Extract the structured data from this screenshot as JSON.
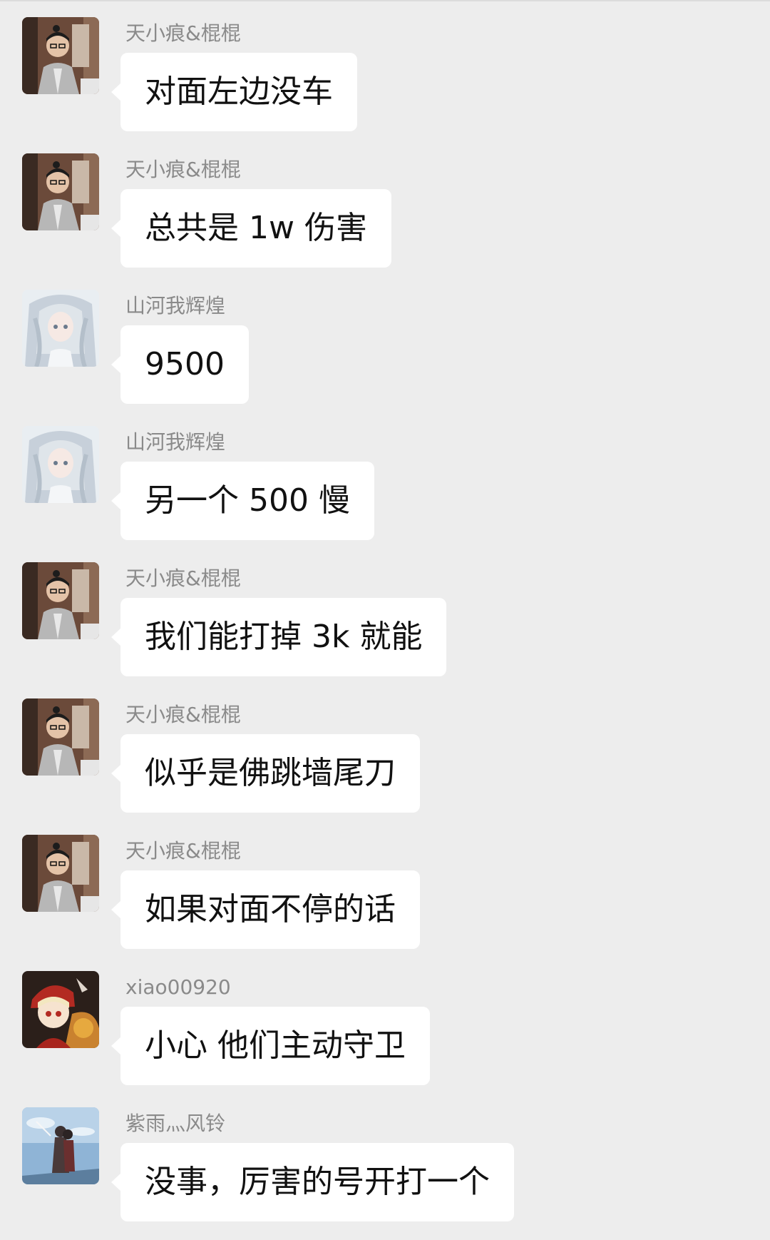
{
  "chat": {
    "background": "#ededed",
    "bubble_color": "#ffffff",
    "messages": [
      {
        "sender": "天小痕&棍棍",
        "text": "对面左边没车",
        "avatar": "avatar-man"
      },
      {
        "sender": "天小痕&棍棍",
        "text": "总共是 1w 伤害",
        "avatar": "avatar-man"
      },
      {
        "sender": "山河我辉煌",
        "text": "9500",
        "avatar": "avatar-anime-girl"
      },
      {
        "sender": "山河我辉煌",
        "text": "另一个 500 慢",
        "avatar": "avatar-anime-girl"
      },
      {
        "sender": "天小痕&棍棍",
        "text": "我们能打掉 3k 就能",
        "avatar": "avatar-man"
      },
      {
        "sender": "天小痕&棍棍",
        "text": "似乎是佛跳墙尾刀",
        "avatar": "avatar-man"
      },
      {
        "sender": "天小痕&棍棍",
        "text": "如果对面不停的话",
        "avatar": "avatar-man"
      },
      {
        "sender": "xiao00920",
        "text": "小心 他们主动守卫",
        "avatar": "avatar-chibi"
      },
      {
        "sender": "紫雨灬风铃",
        "text": "没事，厉害的号开打一个",
        "avatar": "avatar-sky-couple"
      }
    ]
  }
}
